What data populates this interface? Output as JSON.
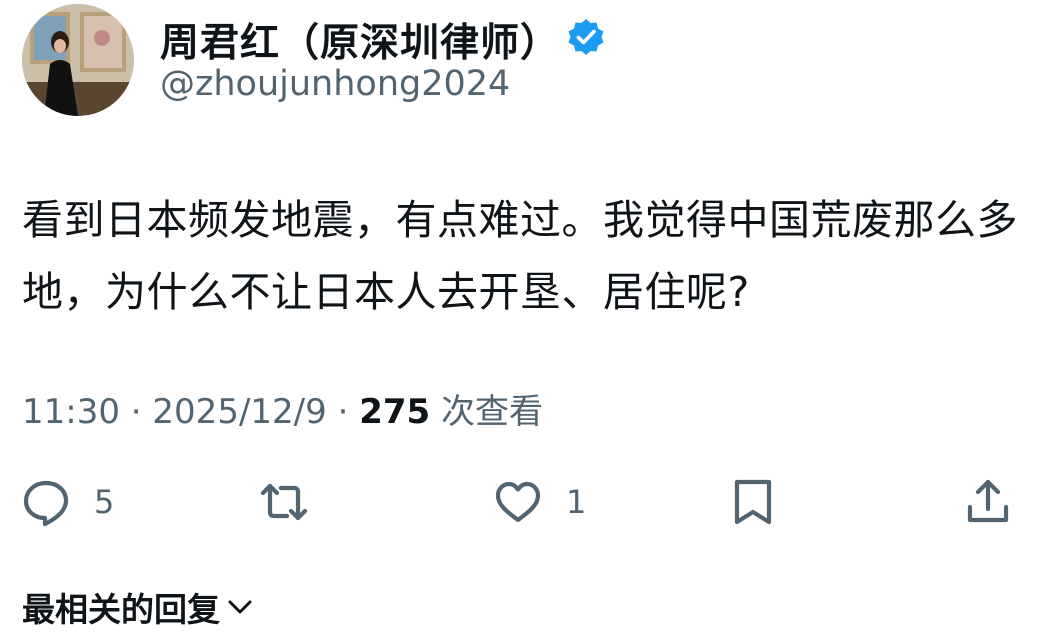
{
  "author": {
    "display_name": "周君红（原深圳律师）",
    "handle": "@zhoujunhong2024",
    "verified": true
  },
  "tweet": {
    "text": "看到日本频发地震，有点难过。我觉得中国荒废那么多地，为什么不让日本人去开垦、居住呢?"
  },
  "meta": {
    "time": "11:30",
    "separator": " · ",
    "date": "2025/12/9",
    "views_count": "275",
    "views_label": " 次查看"
  },
  "actions": {
    "reply_count": "5",
    "like_count": "1",
    "icons": [
      "reply-icon",
      "retweet-icon",
      "like-icon",
      "bookmark-icon",
      "share-icon"
    ]
  },
  "replies": {
    "sort_label": "最相关的回复"
  },
  "colors": {
    "verified": "#1d9bf0",
    "text": "#0f1419",
    "muted": "#536471"
  }
}
